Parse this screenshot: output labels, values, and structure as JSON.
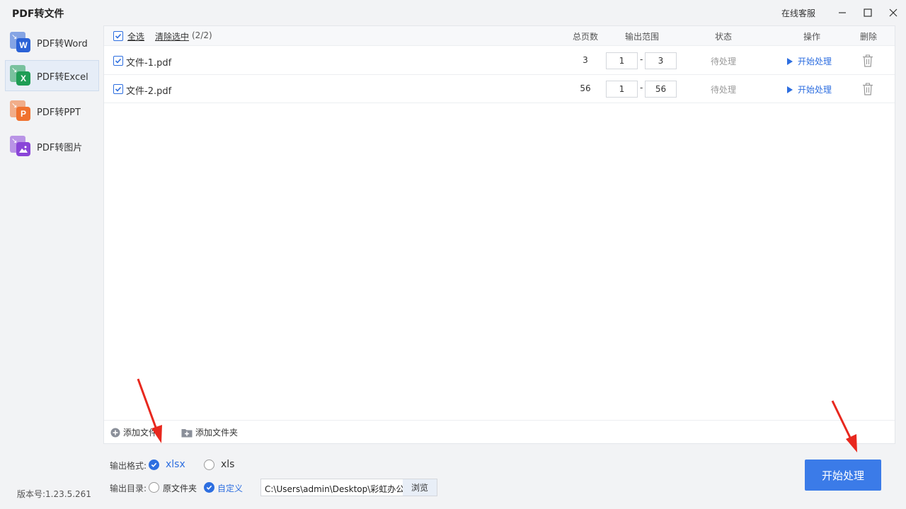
{
  "app": {
    "title": "PDF转文件",
    "service_label": "在线客服"
  },
  "sidebar": {
    "items": [
      {
        "label": "PDF转Word",
        "letter": "W",
        "color": "#2b62d6"
      },
      {
        "label": "PDF转Excel",
        "letter": "X",
        "color": "#1f9d55",
        "active": true
      },
      {
        "label": "PDF转PPT",
        "letter": "P",
        "color": "#f0722f"
      },
      {
        "label": "PDF转图片",
        "letter": "",
        "color": "#8a45d8"
      }
    ],
    "version": "版本号:1.23.5.261"
  },
  "table": {
    "select_all": "全选",
    "clear_selection": "清除选中",
    "selection_count": "(2/2)",
    "headers": {
      "pages": "总页数",
      "range": "输出范围",
      "status": "状态",
      "action": "操作",
      "delete": "删除"
    },
    "rows": [
      {
        "name": "文件-1.pdf",
        "pages": "3",
        "range_from": "1",
        "range_to": "3",
        "status": "待处理",
        "action": "开始处理"
      },
      {
        "name": "文件-2.pdf",
        "pages": "56",
        "range_from": "1",
        "range_to": "56",
        "status": "待处理",
        "action": "开始处理"
      }
    ],
    "range_separator": "-"
  },
  "footer": {
    "add_file": "添加文件",
    "add_folder": "添加文件夹"
  },
  "output": {
    "format_label": "输出格式:",
    "format_options": [
      "xlsx",
      "xls"
    ],
    "format_selected": "xlsx",
    "dir_label": "输出目录:",
    "dir_options": [
      "原文件夹",
      "自定义"
    ],
    "dir_selected": "自定义",
    "path": "C:\\Users\\admin\\Desktop\\彩虹办公",
    "browse": "浏览"
  },
  "start_button": "开始处理",
  "colors": {
    "accent": "#2d6ee0",
    "primary_button": "#3b7be8",
    "annotation_arrow": "#e8281e"
  }
}
